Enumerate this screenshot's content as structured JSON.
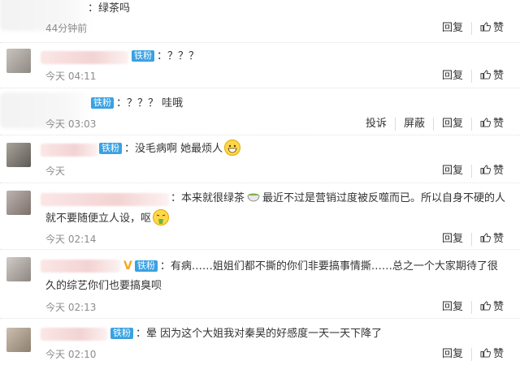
{
  "comments": [
    {
      "text": "：绿茶吗",
      "time": "44分钟前",
      "actions": [
        "回复",
        "赞"
      ]
    },
    {
      "badge": "铁粉",
      "text": "：？？？",
      "time": "今天 04:11",
      "actions": [
        "回复",
        "赞"
      ]
    },
    {
      "badge": "铁粉",
      "text": "：？？？ 哇哦",
      "time": "今天 03:03",
      "actions": [
        "投诉",
        "屏蔽",
        "回复",
        "赞"
      ]
    },
    {
      "badge": "铁粉",
      "text": "：没毛病啊 她最烦人",
      "time": "今天",
      "actions": [
        "回复",
        "赞"
      ]
    },
    {
      "text_a": "：本来就很绿茶",
      "text_b": "最近不过是营销过度被反噬而已。所以自身不硬的人",
      "text_c": "就不要随便立人设，呕",
      "time": "今天 02:14",
      "actions": [
        "回复",
        "赞"
      ]
    },
    {
      "vip": "V",
      "badge": "铁粉",
      "line1": "：有病……姐姐们都不撕的你们非要搞事情撕……总之一个大家期待了很",
      "line2": "久的综艺你们也要搞臭呗",
      "time": "今天 02:13",
      "actions": [
        "回复",
        "赞"
      ]
    },
    {
      "badge": "铁粉",
      "text": "：晕 因为这个大姐我对秦昊的好感度一天一天下降了",
      "time": "今天 02:10",
      "actions": [
        "回复",
        "赞"
      ]
    }
  ],
  "icons": {
    "like": "thumbs-up-icon",
    "grin": "grinning-emoji-icon",
    "tea": "tea-bowl-emoji-icon",
    "vomit": "vomiting-emoji-icon"
  }
}
